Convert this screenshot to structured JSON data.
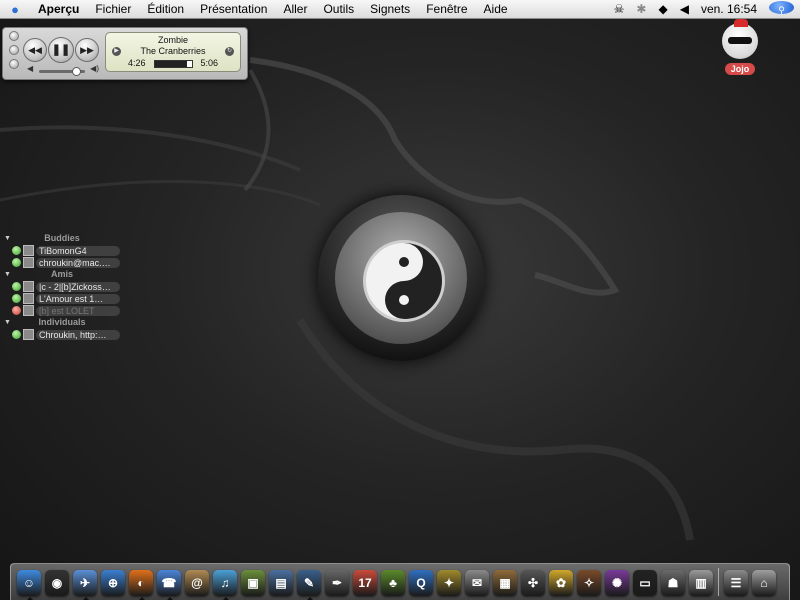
{
  "menubar": {
    "app": "Aperçu",
    "menus": [
      "Fichier",
      "Édition",
      "Présentation",
      "Aller",
      "Outils",
      "Signets",
      "Fenêtre",
      "Aide"
    ],
    "clock": "ven. 16:54"
  },
  "player": {
    "song": "Zombie",
    "artist": "The Cranberries",
    "elapsed": "4:26",
    "total": "5:06",
    "progress": 0.87,
    "volume": 0.8
  },
  "user": {
    "name": "Jojo"
  },
  "buddies": {
    "groups": [
      {
        "name": "Buddies",
        "items": [
          {
            "name": "TiBomonG4",
            "status": "available"
          },
          {
            "name": "chroukin@mac.…",
            "status": "available"
          }
        ]
      },
      {
        "name": "Amis",
        "items": [
          {
            "name": "|c - 2|[b]Zickoss…",
            "status": "available"
          },
          {
            "name": "L'Amour est 1…",
            "status": "available"
          },
          {
            "name": "[b] est LOLET",
            "status": "away"
          }
        ]
      },
      {
        "name": "Individuals",
        "items": [
          {
            "name": "Chroukin, http:…",
            "status": "available"
          }
        ]
      }
    ]
  },
  "dock": {
    "apps": [
      {
        "icon": "finder-icon",
        "glyph": "☺",
        "color": "#3d8be0",
        "running": true
      },
      {
        "icon": "dashboard-icon",
        "glyph": "◉",
        "color": "#333333",
        "running": false
      },
      {
        "icon": "mail-icon",
        "glyph": "✈",
        "color": "#5a8fd6",
        "running": true
      },
      {
        "icon": "safari-icon",
        "glyph": "⊕",
        "color": "#3b7fd3",
        "running": false
      },
      {
        "icon": "firefox-icon",
        "glyph": "◐",
        "color": "#e0701a",
        "running": true
      },
      {
        "icon": "ichat-icon",
        "glyph": "☎",
        "color": "#4a84d8",
        "running": true
      },
      {
        "icon": "address-book-icon",
        "glyph": "@",
        "color": "#b08a52",
        "running": false
      },
      {
        "icon": "itunes-icon",
        "glyph": "♫",
        "color": "#4aa0d8",
        "running": true
      },
      {
        "icon": "iphoto-icon",
        "glyph": "▣",
        "color": "#6a8f3a",
        "running": false
      },
      {
        "icon": "iphoto-library-icon",
        "glyph": "▤",
        "color": "#4a6fa0",
        "running": false
      },
      {
        "icon": "preview-icon",
        "glyph": "✎",
        "color": "#3a5f8a",
        "running": true
      },
      {
        "icon": "pen-tool-icon",
        "glyph": "✒",
        "color": "#666666",
        "running": false
      },
      {
        "icon": "ical-icon",
        "glyph": "17",
        "color": "#c94a3a",
        "running": false
      },
      {
        "icon": "mascot-icon",
        "glyph": "♣",
        "color": "#5a8a2a",
        "running": false
      },
      {
        "icon": "quicktime-icon",
        "glyph": "Q",
        "color": "#2f6fc0",
        "running": false
      },
      {
        "icon": "clapboard-icon",
        "glyph": "✦",
        "color": "#a08a2a",
        "running": false
      },
      {
        "icon": "textedit-icon",
        "glyph": "✉",
        "color": "#8a8a8a",
        "running": false
      },
      {
        "icon": "package-icon",
        "glyph": "▦",
        "color": "#8f6a3a",
        "running": false
      },
      {
        "icon": "compass-icon",
        "glyph": "✣",
        "color": "#555555",
        "running": false
      },
      {
        "icon": "stickies-icon",
        "glyph": "✿",
        "color": "#d0a82a",
        "running": false
      },
      {
        "icon": "tools-icon",
        "glyph": "✧",
        "color": "#7a4a2a",
        "running": false
      },
      {
        "icon": "aim-icon",
        "glyph": "✺",
        "color": "#7a3a9a",
        "running": false
      },
      {
        "icon": "terminal-icon",
        "glyph": "▭",
        "color": "#222222",
        "running": false
      },
      {
        "icon": "system-preferences-icon",
        "glyph": "☗",
        "color": "#6a6a6a",
        "running": false
      },
      {
        "icon": "printer-icon",
        "glyph": "▥",
        "color": "#9a9a9a",
        "running": false
      }
    ],
    "trailing": [
      {
        "icon": "stacks-folder-icon",
        "glyph": "☰",
        "color": "#8a8a8a",
        "running": false
      },
      {
        "icon": "trash-icon",
        "glyph": "⌂",
        "color": "#9f9f9f",
        "running": false
      }
    ]
  }
}
